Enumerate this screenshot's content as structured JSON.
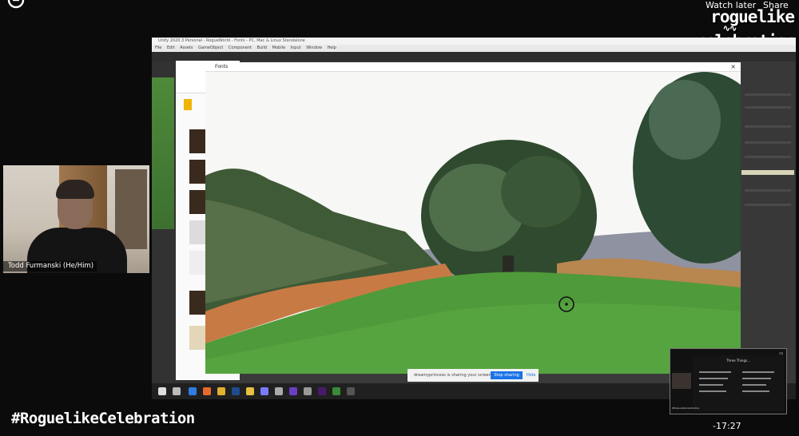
{
  "header": {
    "watch_later": "Watch later",
    "share": "Share"
  },
  "event_logo": {
    "line1": "roguelike",
    "line2": "celebration"
  },
  "webcam": {
    "name": "Todd Furmanski (He/Him)"
  },
  "unity": {
    "title": "Unity 2020.3 Personal - RogueWorld - Fonts - PC, Mac & Linux Standalone",
    "menu": [
      "File",
      "Edit",
      "Assets",
      "GameObject",
      "Component",
      "Build",
      "Mobile Input",
      "Window",
      "Help"
    ]
  },
  "fonts_window": {
    "title": "Fonts",
    "close": "×"
  },
  "screen_share_bar": {
    "message": "dreamyprincess is sharing your screen.",
    "stop": "Stop sharing",
    "hide": "Hide"
  },
  "overlay": {
    "hashtag": "#RoguelikeCelebration",
    "timer": "-17:27"
  },
  "pip": {
    "title": "Three Things...",
    "logo": "rc",
    "speaker_tag": "#RoguelikeCelebration"
  },
  "colors": {
    "stop_button": "#1a73e8",
    "grass": "#4f9a3a",
    "background": "#0b0b0b"
  }
}
